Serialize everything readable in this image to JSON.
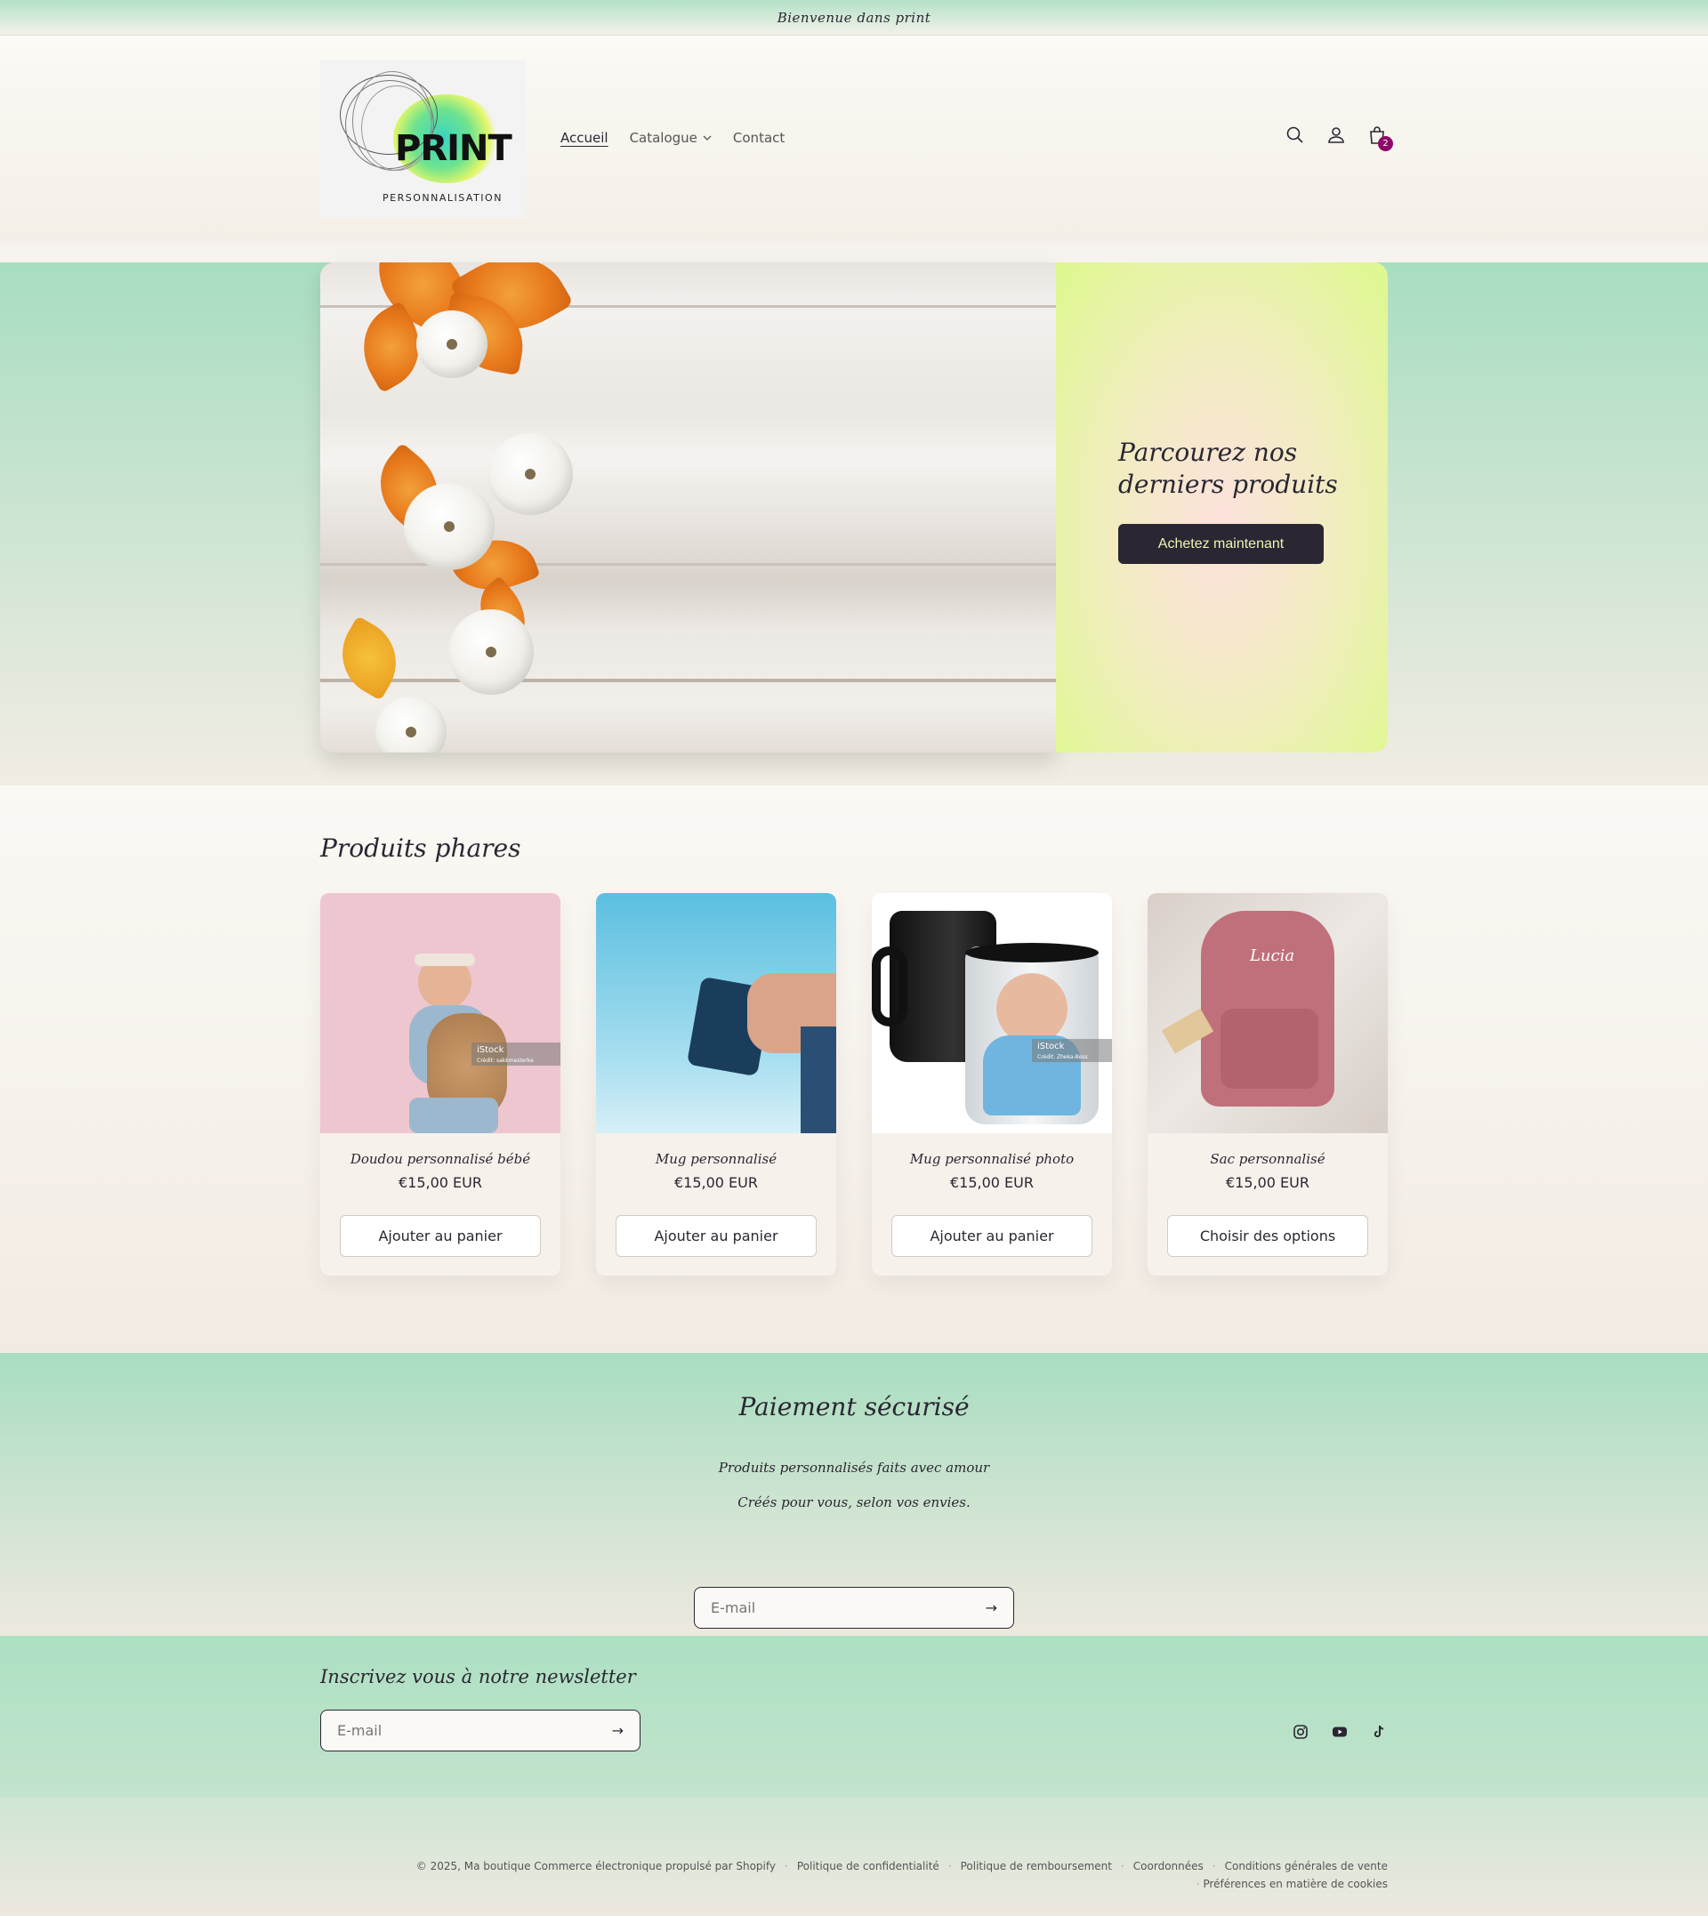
{
  "announcement": {
    "text": "Bienvenue dans print"
  },
  "logo": {
    "word": "PRINT",
    "sub": "PERSONNALISATION"
  },
  "nav": {
    "items": [
      {
        "label": "Accueil",
        "active": true
      },
      {
        "label": "Catalogue",
        "dropdown": true
      },
      {
        "label": "Contact"
      }
    ]
  },
  "header_icons": {
    "search": "search-icon",
    "account": "user-icon",
    "cart": "bag-icon",
    "cart_count": "2"
  },
  "hero": {
    "title_line1": "Parcourez nos",
    "title_line2": "derniers produits",
    "button": "Achetez maintenant"
  },
  "featured": {
    "title": "Produits phares",
    "products": [
      {
        "name": "Doudou personnalisé bébé",
        "price": "€15,00 EUR",
        "button": "Ajouter au panier",
        "credit_brand": "iStock",
        "credit": "Crédit: sakkmesterke"
      },
      {
        "name": "Mug personnalisé",
        "price": "€15,00 EUR",
        "button": "Ajouter au panier"
      },
      {
        "name": "Mug personnalisé photo",
        "price": "€15,00 EUR",
        "button": "Ajouter au panier",
        "credit_brand": "iStock",
        "credit": "Crédit: Zheka-Boss"
      },
      {
        "name": "Sac personnalisé",
        "price": "€15,00 EUR",
        "button": "Choisir des options",
        "bag_text": "Lucia"
      }
    ]
  },
  "secure": {
    "title": "Paiement sécurisé",
    "line1": "Produits personnalisés faits avec amour",
    "line2": "Créés pour vous, selon vos envies.",
    "email_placeholder": "E-mail"
  },
  "newsletter": {
    "title": "Inscrivez vous à notre newsletter",
    "email_placeholder": "E-mail",
    "socials": [
      "instagram-icon",
      "youtube-icon",
      "tiktok-icon"
    ]
  },
  "footer": {
    "copyright": "© 2025, Ma boutique Commerce électronique propulsé par Shopify",
    "links": [
      "Politique de confidentialité",
      "Politique de remboursement",
      "Coordonnées",
      "Conditions générales de vente"
    ],
    "link_last": "Préférences en matière de cookies"
  },
  "colors": {
    "accent": "#8d0a68",
    "dark": "#2a2733",
    "mint": "#a8dec0",
    "lime": "#def98e"
  }
}
